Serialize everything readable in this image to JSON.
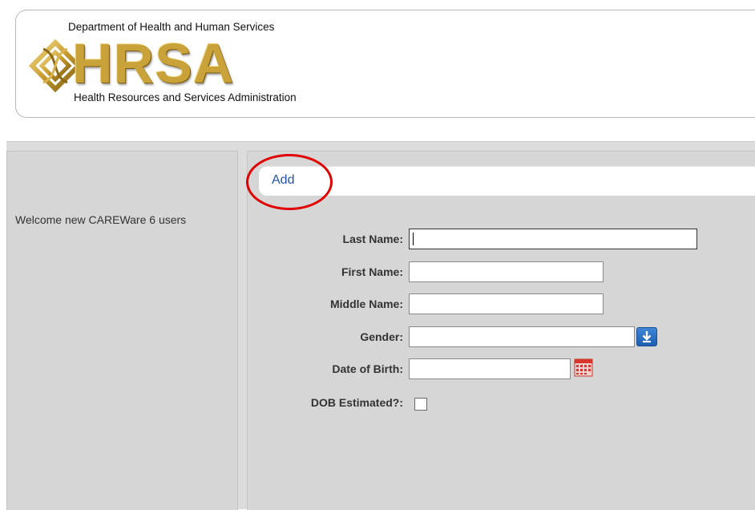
{
  "header": {
    "department": "Department of Health and Human Services",
    "logo_text": "HRSA",
    "agency": "Health Resources and Services Administration"
  },
  "sidebar": {
    "welcome_text": "Welcome new CAREWare 6 users"
  },
  "toolbar": {
    "add_label": "Add"
  },
  "form": {
    "last_name": {
      "label": "Last Name:",
      "value": ""
    },
    "first_name": {
      "label": "First Name:",
      "value": ""
    },
    "middle_name": {
      "label": "Middle Name:",
      "value": ""
    },
    "gender": {
      "label": "Gender:",
      "value": ""
    },
    "dob": {
      "label": "Date of Birth:",
      "value": ""
    },
    "dob_estimated": {
      "label": "DOB Estimated?:",
      "checked": false
    }
  },
  "colors": {
    "highlight_circle": "#e00000",
    "link": "#2255aa",
    "logo_gold": "#caa23a"
  },
  "icons": [
    "hrsa-emblem-icon",
    "download-arrow-icon",
    "calendar-icon"
  ]
}
